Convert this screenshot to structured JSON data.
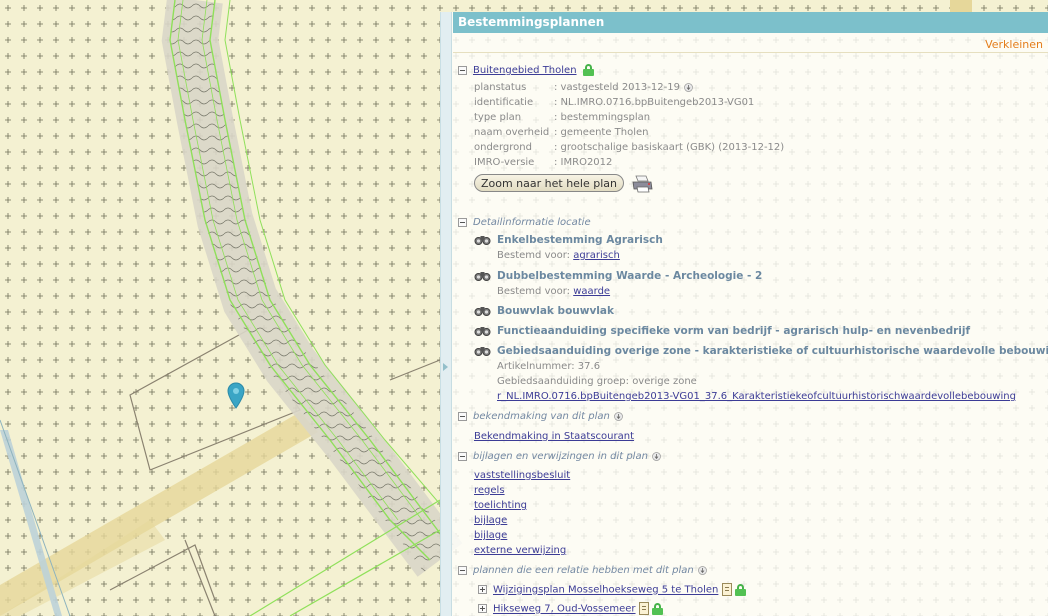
{
  "panel": {
    "header": "Bestemmingsplannen",
    "shrink_label": "Verkleinen"
  },
  "plan": {
    "title": "Buitengebied Tholen",
    "props": [
      {
        "key": "planstatus",
        "value": ": vastgesteld 2013-12-19"
      },
      {
        "key": "identificatie",
        "value": ": NL.IMRO.0716.bpBuitengeb2013-VG01"
      },
      {
        "key": "type plan",
        "value": ": bestemmingsplan"
      },
      {
        "key": "naam overheid",
        "value": ": gemeente Tholen"
      },
      {
        "key": "ondergrond",
        "value": ": grootschalige basiskaart (GBK) (2013-12-12)"
      },
      {
        "key": "IMRO-versie",
        "value": ": IMRO2012"
      }
    ],
    "zoom_button": "Zoom naar het hele plan"
  },
  "detail": {
    "heading": "Detailinformatie locatie",
    "items": [
      {
        "title": "Enkelbestemming Agrarisch",
        "sub_prefix": "Bestemd voor: ",
        "sub_link": "agrarisch"
      },
      {
        "title": "Dubbelbestemming Waarde - Archeologie - 2",
        "sub_prefix": "Bestemd voor: ",
        "sub_link": "waarde"
      },
      {
        "title": "Bouwvlak bouwvlak"
      },
      {
        "title": "Functieaanduiding specifieke vorm van bedrijf - agrarisch hulp- en nevenbedrijf"
      },
      {
        "title": "Gebiedsaanduiding overige zone - karakteristieke of cultuurhistorische waardevolle bebouwing",
        "lines": [
          "Artikelnummer: 37.6",
          "Gebiedsaanduiding groep: overige zone"
        ],
        "link": "r_NL.IMRO.0716.bpBuitengeb2013-VG01_37.6_Karakteristiekeofcultuurhistorischwaardevollebebouwing"
      }
    ]
  },
  "bekendmaking": {
    "heading": "bekendmaking van dit plan",
    "link": "Bekendmaking in Staatscourant"
  },
  "bijlagen": {
    "heading": "bijlagen en verwijzingen in dit plan",
    "links": [
      "vaststellingsbesluit",
      "regels",
      "toelichting",
      "bijlage",
      "bijlage",
      "externe verwijzing"
    ]
  },
  "related": {
    "heading": "plannen die een relatie hebben met dit plan",
    "items": [
      "Wijzigingsplan Mosselhoekseweg 5 te Tholen",
      "Hikseweg 7, Oud-Vossemeer"
    ]
  },
  "colors": {
    "header_bg": "#7cc0cb",
    "shrink_text": "#e47d1b",
    "link": "#3c3c96",
    "detail_title": "#6b88a0",
    "map_bg": "#f4f1d2",
    "road_green": "#8fe05a"
  }
}
